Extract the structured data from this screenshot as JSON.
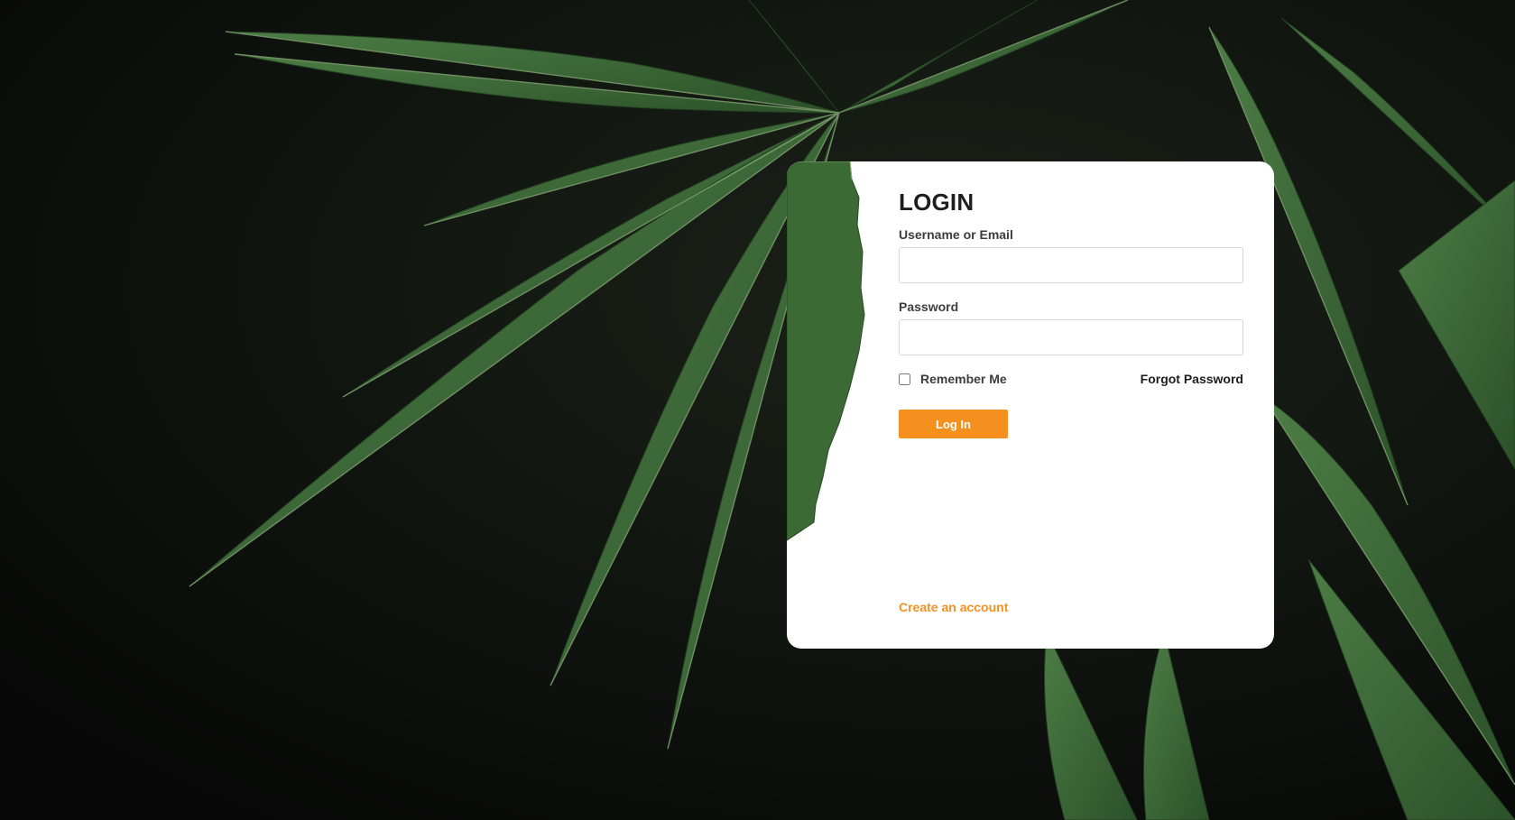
{
  "background": {
    "description_icon": "cannabis-leaf-photo",
    "colors": {
      "dark": "#0d0f0d",
      "leaf": "#3f6b3a",
      "leaf_light": "#5d8a52"
    }
  },
  "login": {
    "title": "LOGIN",
    "username_label": "Username or Email",
    "username_value": "",
    "password_label": "Password",
    "password_value": "",
    "remember_label": "Remember Me",
    "remember_checked": false,
    "forgot_label": "Forgot Password",
    "submit_label": "Log In",
    "create_account_label": "Create an account"
  },
  "colors": {
    "accent": "#f5901f",
    "card": "#ffffff",
    "text": "#1e1e1e"
  }
}
